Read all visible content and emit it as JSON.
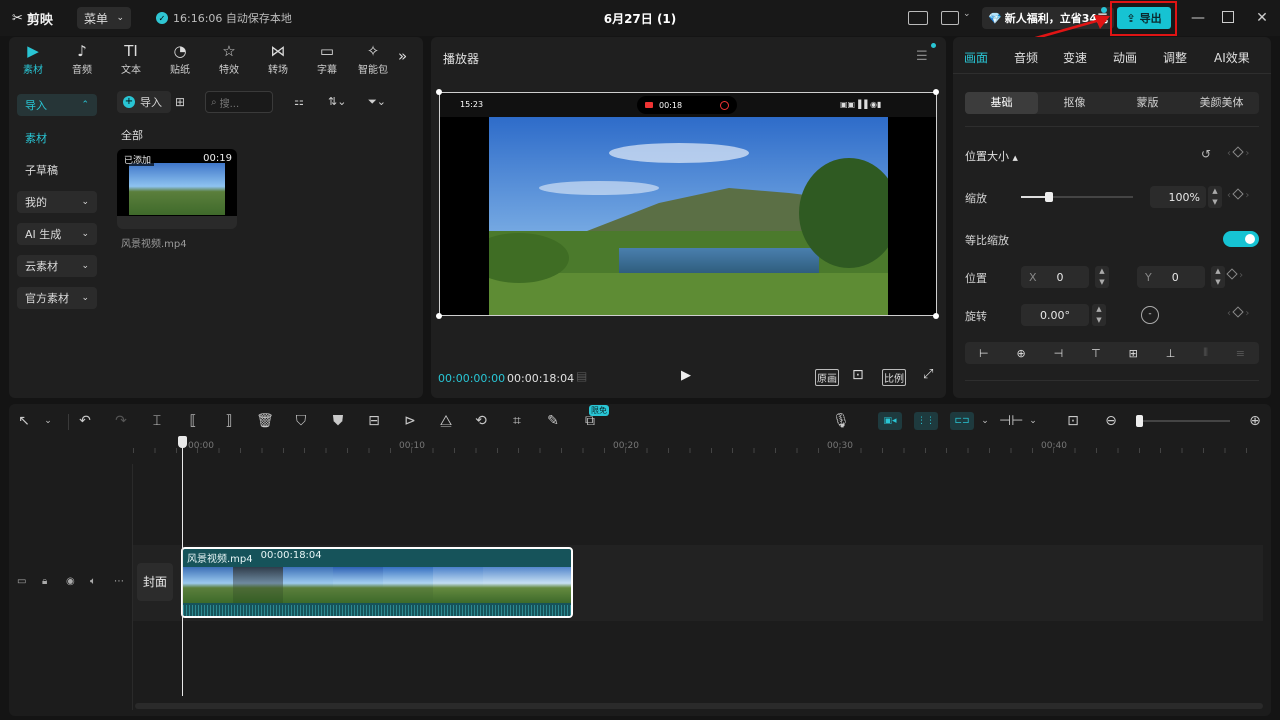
{
  "app": {
    "logo": "剪映",
    "menu_label": "菜单",
    "autosave": "16:16:06 自动保存本地",
    "project_title": "6月27日 (1)",
    "promo": "新人福利，立省34元",
    "export_label": "导出"
  },
  "media_tabs": [
    {
      "label": "素材",
      "icon": "media-icon"
    },
    {
      "label": "音频",
      "icon": "audio-icon"
    },
    {
      "label": "文本",
      "icon": "text-icon"
    },
    {
      "label": "贴纸",
      "icon": "sticker-icon"
    },
    {
      "label": "特效",
      "icon": "effects-icon"
    },
    {
      "label": "转场",
      "icon": "transition-icon"
    },
    {
      "label": "字幕",
      "icon": "subtitle-icon"
    },
    {
      "label": "智能包",
      "icon": "smart-icon"
    }
  ],
  "sidebar": {
    "items": [
      "导入",
      "素材",
      "子草稿",
      "我的",
      "AI 生成",
      "云素材",
      "官方素材"
    ]
  },
  "media": {
    "import_label": "导入",
    "search_placeholder": "搜...",
    "section_label": "全部",
    "clip_badge": "已添加",
    "clip_duration": "00:19",
    "clip_name": "风景视频.mp4"
  },
  "player": {
    "title": "播放器",
    "status_time": "15:23",
    "rec_time": "00:18",
    "current_time": "00:00:00:00",
    "total_time": "00:00:18:04",
    "btn_original": "原画",
    "btn_ratio": "比例"
  },
  "inspector": {
    "tabs": [
      "画面",
      "音频",
      "变速",
      "动画",
      "调整",
      "AI效果"
    ],
    "sub_tabs": [
      "基础",
      "抠像",
      "蒙版",
      "美颜美体"
    ],
    "section": "位置大小",
    "scale_label": "缩放",
    "scale_value": "100%",
    "scale_level": 0.25,
    "uniform_label": "等比缩放",
    "position_label": "位置",
    "x_label": "X",
    "x_value": "0",
    "y_label": "Y",
    "y_value": "0",
    "rotate_label": "旋转",
    "rotate_value": "0.00°"
  },
  "timeline": {
    "free_badge": "限免",
    "ruler": [
      "00:00",
      "00:10",
      "00:20",
      "00:30",
      "00:40"
    ],
    "cover_label": "封面",
    "clip_name": "风景视频.mp4",
    "clip_duration": "00:00:18:04"
  },
  "colors": {
    "accent": "#29c5d4",
    "export": "#16c3d3",
    "highlight": "#e01414",
    "clip": "#16535a"
  }
}
